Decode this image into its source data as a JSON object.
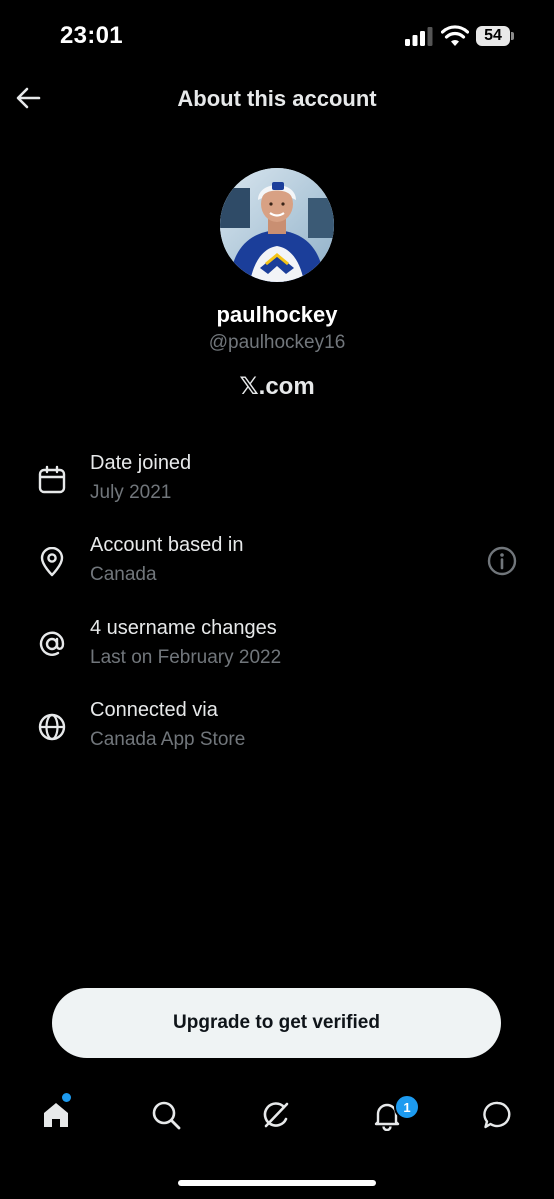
{
  "status_bar": {
    "time": "23:01",
    "battery": "54"
  },
  "header": {
    "title": "About this account",
    "back_icon": "arrow-left-icon"
  },
  "profile": {
    "display_name": "paulhockey",
    "handle": "@paulhockey16",
    "site": "𝕏.com"
  },
  "details": [
    {
      "icon": "calendar-icon",
      "title": "Date joined",
      "subtitle": "July 2021"
    },
    {
      "icon": "location-pin-icon",
      "title": "Account based in",
      "subtitle": "Canada",
      "info_icon": "info-icon"
    },
    {
      "icon": "at-sign-icon",
      "title": "4 username changes",
      "subtitle": "Last on February 2022"
    },
    {
      "icon": "globe-icon",
      "title": "Connected via",
      "subtitle": "Canada App Store"
    }
  ],
  "upgrade_button": {
    "label": "Upgrade to get verified"
  },
  "bottom_nav": {
    "items": [
      "home-icon",
      "search-icon",
      "grok-icon",
      "notifications-icon",
      "messages-icon"
    ],
    "notification_count": "1"
  },
  "colors": {
    "background": "#000000",
    "primary_text": "#e7e9ea",
    "secondary_text": "#71767b",
    "accent": "#1d9bf0",
    "button_bg": "#eff3f4"
  }
}
